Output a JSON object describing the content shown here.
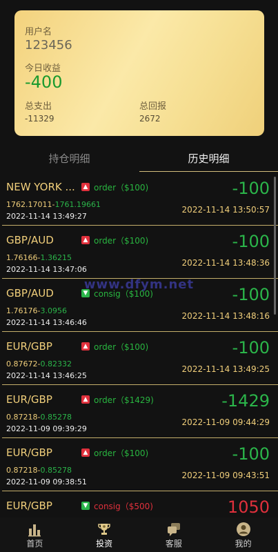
{
  "card": {
    "username_label": "用户名",
    "username": "123456",
    "today_label": "今日收益",
    "today_value": "-400",
    "expense_label": "总支出",
    "expense_value": "-11329",
    "return_label": "总回报",
    "return_value": "2672"
  },
  "tabs": {
    "positions": "持仓明细",
    "history": "历史明细"
  },
  "watermark": "www.dfym.net",
  "records": [
    {
      "pair": "NEW YORK ...",
      "direction": "up",
      "order_type": "order（$100)",
      "open_price": "1762.17011",
      "close_price": "1761.19661",
      "open_time": "2022-11-14 13:49:27",
      "amount": "-100",
      "close_time": "2022-11-14 13:50:57"
    },
    {
      "pair": "GBP/AUD",
      "direction": "up",
      "order_type": "order（$100)",
      "open_price": "1.76166",
      "close_price": "1.36215",
      "open_time": "2022-11-14 13:47:06",
      "amount": "-100",
      "close_time": "2022-11-14 13:48:36"
    },
    {
      "pair": "GBP/AUD",
      "direction": "down",
      "order_type": "consig（$100)",
      "open_price": "1.76176",
      "close_price": "3.0956",
      "open_time": "2022-11-14 13:46:46",
      "amount": "-100",
      "close_time": "2022-11-14 13:48:16"
    },
    {
      "pair": "EUR/GBP",
      "direction": "up",
      "order_type": "order（$100)",
      "open_price": "0.87672",
      "close_price": "0.82332",
      "open_time": "2022-11-14 13:46:25",
      "amount": "-100",
      "close_time": "2022-11-14 13:49:25"
    },
    {
      "pair": "EUR/GBP",
      "direction": "up",
      "order_type": "order（$1429)",
      "open_price": "0.87218",
      "close_price": "0.85278",
      "open_time": "2022-11-09 09:39:29",
      "amount": "-1429",
      "close_time": "2022-11-09 09:44:29"
    },
    {
      "pair": "EUR/GBP",
      "direction": "up",
      "order_type": "order（$100)",
      "open_price": "0.87218",
      "close_price": "0.85278",
      "open_time": "2022-11-09 09:38:51",
      "amount": "-100",
      "close_time": "2022-11-09 09:43:51"
    },
    {
      "pair": "EUR/GBP",
      "direction": "down",
      "order_type": "consig（$500)",
      "open_price": "",
      "close_price": "",
      "open_time": "",
      "amount": "1050",
      "close_time": ""
    }
  ],
  "nav": {
    "home": "首页",
    "invest": "投资",
    "service": "客服",
    "mine": "我的"
  },
  "colors": {
    "accent_gold": "#f1cf7b",
    "loss_green": "#2bb54a",
    "gain_red": "#e0303c",
    "background": "#121212"
  },
  "icons": {
    "up": "arrow-up-icon",
    "down": "arrow-down-icon",
    "home": "bar-chart-icon",
    "invest": "trophy-icon",
    "service": "chat-bubbles-icon",
    "mine": "user-avatar-icon"
  }
}
